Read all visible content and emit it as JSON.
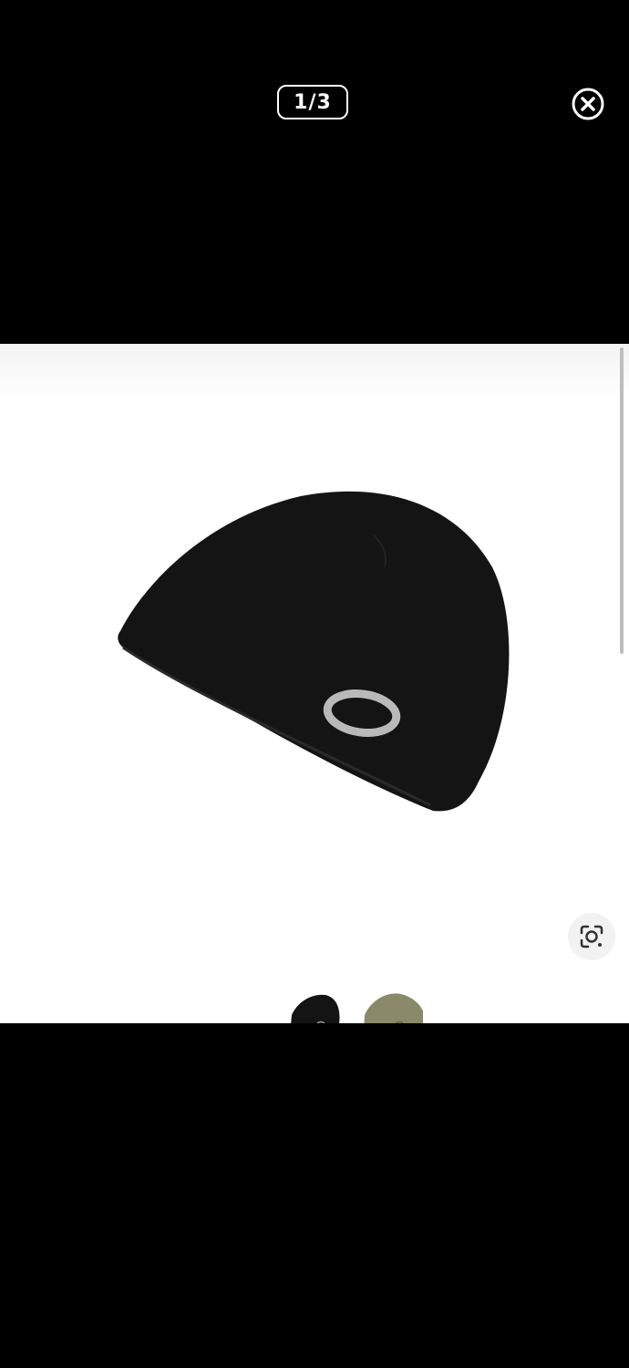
{
  "viewer": {
    "counter_text": "1/3",
    "close_icon": "close-circle-icon",
    "lens_icon": "visual-search-icon"
  },
  "colors": {
    "background": "#000000",
    "panel": "#ffffff",
    "beanie_black": "#141414",
    "beanie_olive": "#8a8a6a",
    "logo_gray": "#b9b9b9"
  },
  "thumbnails": [
    {
      "name": "black-beanie-thumbnail"
    },
    {
      "name": "olive-beanie-thumbnail"
    }
  ]
}
